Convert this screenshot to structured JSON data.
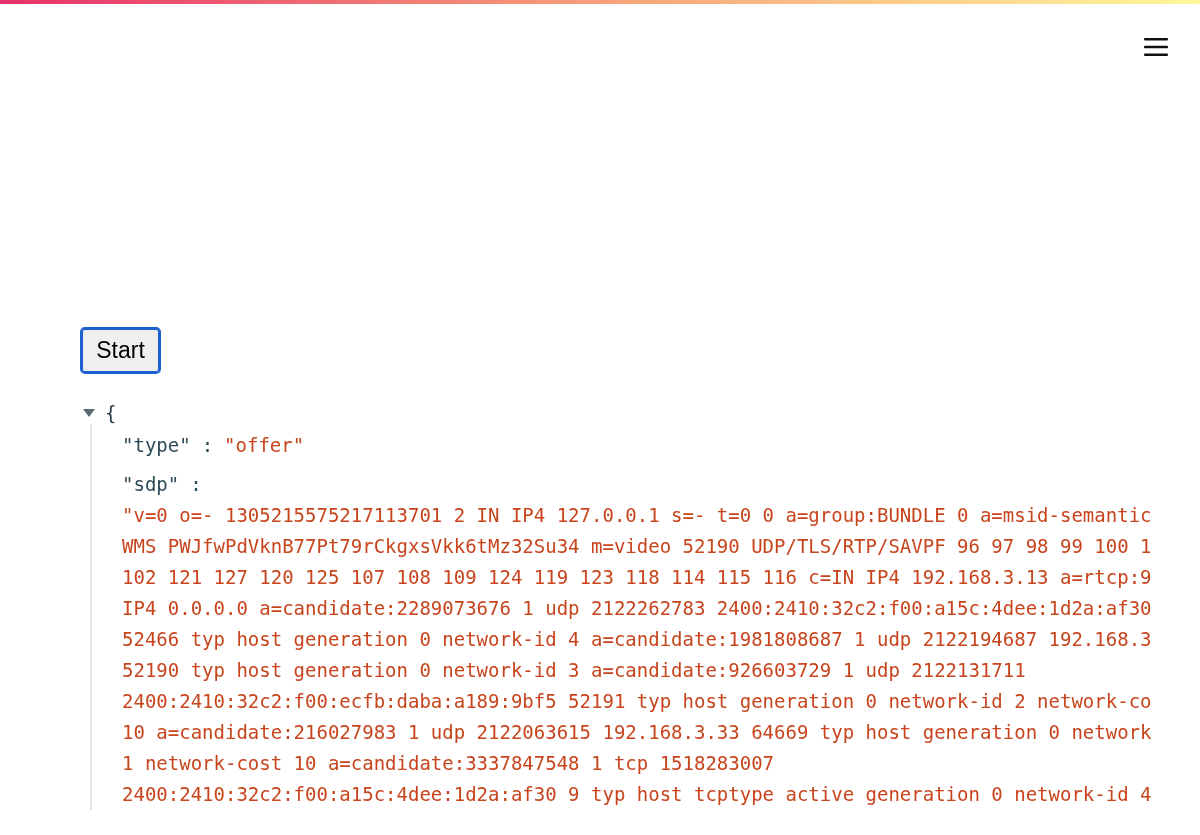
{
  "start_button": {
    "label": "Start",
    "focused": true
  },
  "json_view": {
    "expanded": true,
    "open_brace": "{",
    "entries": [
      {
        "kind": "inline",
        "key": "\"type\"",
        "separator": ":",
        "value_lines": [
          "\"offer\""
        ]
      },
      {
        "kind": "block",
        "key": "\"sdp\"",
        "separator": ":",
        "value_lines": [
          "\"v=0 o=- 1305215575217113701 2 IN IP4 127.0.0.1 s=- t=0 0 a=group:BUNDLE 0 a=msid-semantic",
          "WMS PWJfwPdVknB77Pt79rCkgxsVkk6tMz32Su34 m=video 52190 UDP/TLS/RTP/SAVPF 96 97 98 99 100 1",
          "102 121 127 120 125 107 108 109 124 119 123 118 114 115 116 c=IN IP4 192.168.3.13 a=rtcp:9",
          "IP4 0.0.0.0 a=candidate:2289073676 1 udp 2122262783 2400:2410:32c2:f00:a15c:4dee:1d2a:af30",
          "52466 typ host generation 0 network-id 4 a=candidate:1981808687 1 udp 2122194687 192.168.3",
          "52190 typ host generation 0 network-id 3 a=candidate:926603729 1 udp 2122131711",
          "2400:2410:32c2:f00:ecfb:daba:a189:9bf5 52191 typ host generation 0 network-id 2 network-co",
          "10 a=candidate:216027983 1 udp 2122063615 192.168.3.33 64669 typ host generation 0 network",
          "1 network-cost 10 a=candidate:3337847548 1 tcp 1518283007",
          "2400:2410:32c2:f00:a15c:4dee:1d2a:af30 9 typ host tcptype active generation 0 network-id 4"
        ]
      }
    ]
  }
}
